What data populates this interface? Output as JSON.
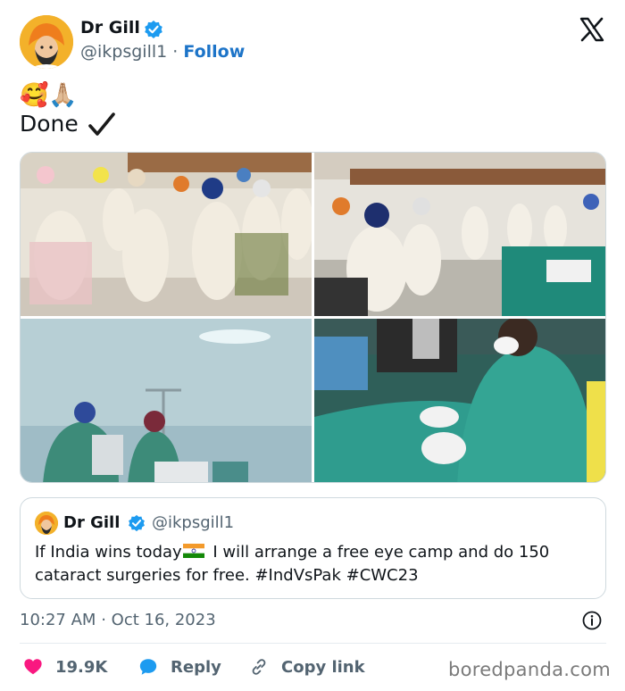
{
  "author": {
    "name": "Dr Gill",
    "handle": "@ikpsgill1",
    "separator": "·",
    "follow_label": "Follow"
  },
  "tweet": {
    "emojis": "🥰🙏🏼",
    "text": "Done"
  },
  "media": {
    "count": 4,
    "photos": [
      "photo-waiting-room-1",
      "photo-waiting-room-2",
      "photo-operating-theatre",
      "photo-cataract-surgery"
    ]
  },
  "quoted_tweet": {
    "name": "Dr Gill",
    "handle": "@ikpsgill1",
    "text_before_flag": "If India wins today",
    "text_after_flag": " I will arrange a free eye camp and do 150 cataract surgeries for free. #IndVsPak #CWC23"
  },
  "meta": {
    "time": "10:27 AM",
    "separator": "·",
    "date": "Oct 16, 2023"
  },
  "actions": {
    "likes": "19.9K",
    "reply_label": "Reply",
    "copy_label": "Copy link"
  },
  "watermark": "boredpanda.com",
  "colors": {
    "verified": "#1d9bf0",
    "follow": "#1d74c8",
    "like": "#f91880",
    "reply": "#1d9bf0",
    "secondary_text": "#536471"
  }
}
